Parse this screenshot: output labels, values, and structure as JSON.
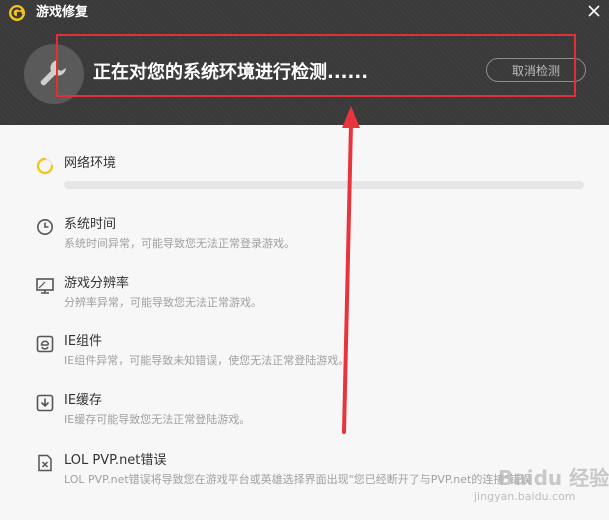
{
  "titlebar": {
    "title": "游戏修复"
  },
  "header": {
    "status_text": "正在对您的系统环境进行检测......",
    "cancel_label": "取消检测",
    "highlight_color": "#e0303a"
  },
  "checks": [
    {
      "title": "网络环境",
      "desc": "",
      "icon": "loading-spinner-icon",
      "state": "checking",
      "progress": 0.0
    },
    {
      "title": "系统时间",
      "desc": "系统时间异常，可能导致您无法正常登录游戏。",
      "icon": "clock-icon"
    },
    {
      "title": "游戏分辨率",
      "desc": "分辨率异常，可能导致您无法正常游戏。",
      "icon": "monitor-icon"
    },
    {
      "title": "IE组件",
      "desc": "IE组件异常，可能导致未知错误，使您无法正常登陆游戏。",
      "icon": "ie-icon"
    },
    {
      "title": "IE缓存",
      "desc": "IE缓存可能导致您无法正常登陆游戏。",
      "icon": "download-box-icon"
    },
    {
      "title": "LOL PVP.net错误",
      "desc": "LOL PVP.net错误将导致您在游戏平台或英雄选择界面出现\"您已经断开了与PVP.net的连接\"错误",
      "icon": "error-file-icon"
    }
  ],
  "colors": {
    "spinner": "#f5c518",
    "arrow": "#e8343c"
  },
  "watermark": {
    "main": "Baidu 经验",
    "sub": "jingyan.baidu.com"
  }
}
